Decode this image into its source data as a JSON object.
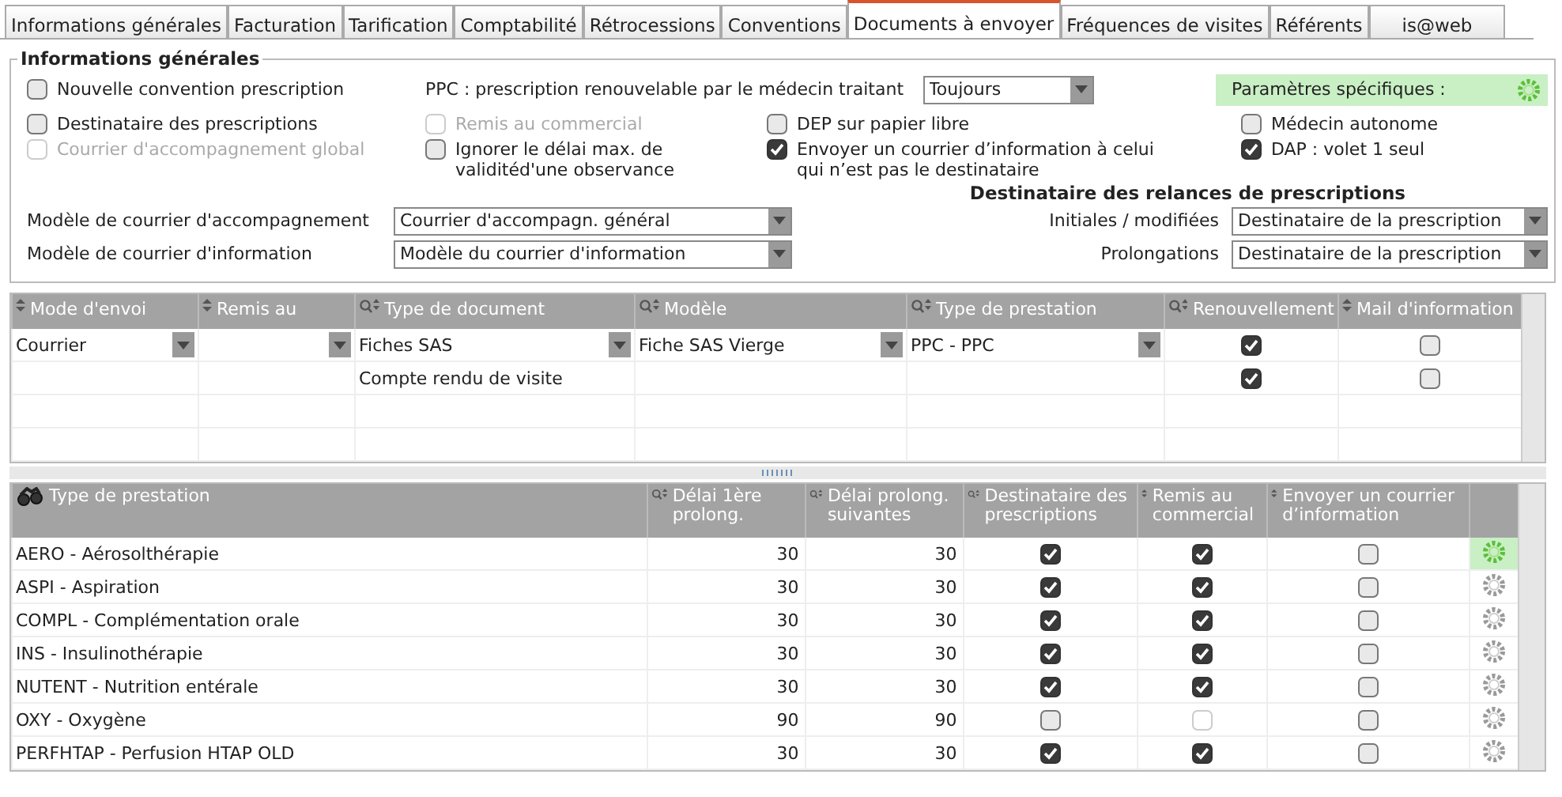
{
  "tabs": [
    {
      "label": "Informations générales",
      "selected": false
    },
    {
      "label": "Facturation",
      "selected": false
    },
    {
      "label": "Tarification",
      "selected": false
    },
    {
      "label": "Comptabilité",
      "selected": false
    },
    {
      "label": "Rétrocessions",
      "selected": false
    },
    {
      "label": "Conventions",
      "selected": false
    },
    {
      "label": "Documents à envoyer",
      "selected": true
    },
    {
      "label": "Fréquences de visites",
      "selected": false
    },
    {
      "label": "Référents",
      "selected": false
    },
    {
      "label": "is@web",
      "selected": false
    }
  ],
  "general": {
    "title": "Informations générales",
    "first_checkbox": {
      "label": "Nouvelle convention prescription",
      "checked": false,
      "disabled": false
    },
    "ppc": {
      "label": "PPC : prescription renouvelable par le médecin traitant",
      "value": "Toujours"
    },
    "specific_params": {
      "label": "Paramètres spécifiques :"
    },
    "checkbox_rows": [
      [
        {
          "label": "Destinataire des prescriptions",
          "checked": false,
          "disabled": false
        },
        {
          "label": "Remis au commercial",
          "checked": false,
          "disabled": true
        },
        {
          "label": "DEP sur papier libre",
          "checked": false,
          "disabled": false
        },
        {
          "label": "Médecin autonome",
          "checked": false,
          "disabled": false
        }
      ],
      [
        {
          "label": "Courrier d'accompagnement global",
          "checked": false,
          "disabled": true
        },
        {
          "label": "Ignorer le délai max. de validitéd'une observance",
          "checked": false,
          "disabled": false
        },
        {
          "label": "Envoyer un courrier d’information à celui qui n’est pas le destinataire",
          "checked": true,
          "disabled": false
        },
        {
          "label": "DAP : volet 1 seul",
          "checked": true,
          "disabled": false
        }
      ]
    ],
    "letter_selects": [
      {
        "label": "Modèle de courrier d'accompagnement",
        "value": "Courrier d'accompagn. général"
      },
      {
        "label": "Modèle de courrier d'information",
        "value": "Modèle du courrier d'information"
      }
    ],
    "reminders": {
      "title": "Destinataire des relances de prescriptions",
      "selects": [
        {
          "label": "Initiales / modifiées",
          "value": "Destinataire de la prescription"
        },
        {
          "label": "Prolongations",
          "value": "Destinataire de la prescription"
        }
      ]
    }
  },
  "documents": {
    "columns": [
      {
        "label": "Mode d'envoi"
      },
      {
        "label": "Remis au"
      },
      {
        "label": "Type de document"
      },
      {
        "label": "Modèle"
      },
      {
        "label": "Type de prestation"
      },
      {
        "label": "Renouvellement"
      },
      {
        "label": "Mail d'information"
      }
    ],
    "rows": [
      [
        {
          "kind": "select",
          "value": "Courrier"
        },
        {
          "kind": "select"
        },
        {
          "kind": "select",
          "value": "Fiches SAS"
        },
        {
          "kind": "select",
          "value": "Fiche SAS Vierge"
        },
        {
          "kind": "select",
          "value": "PPC - PPC"
        },
        {
          "kind": "check",
          "checked": true
        },
        {
          "kind": "check",
          "checked": false
        }
      ],
      [
        {
          "kind": "empty"
        },
        {
          "kind": "empty"
        },
        {
          "kind": "text",
          "value": "Compte rendu de visite"
        },
        {
          "kind": "empty"
        },
        {
          "kind": "empty"
        },
        {
          "kind": "check",
          "checked": true
        },
        {
          "kind": "check",
          "checked": false
        }
      ]
    ]
  },
  "services": {
    "columns": [
      {
        "label": "Type de prestation"
      },
      {
        "label": "Délai 1ère prolong."
      },
      {
        "label": "Délai prolong. suivantes"
      },
      {
        "label": "Destinataire des prescriptions"
      },
      {
        "label": "Remis au commercial"
      },
      {
        "label": "Envoyer un courrier d’information"
      }
    ],
    "rows": [
      {
        "name": "AERO - Aérosolthérapie",
        "first_delay": "30",
        "next_delay": "30",
        "recipient": {
          "checked": true,
          "disabled": false
        },
        "sales": {
          "checked": true,
          "disabled": false
        },
        "send_info": {
          "checked": false,
          "disabled": false
        },
        "highlighted": true
      },
      {
        "name": "ASPI - Aspiration",
        "first_delay": "30",
        "next_delay": "30",
        "recipient": {
          "checked": true,
          "disabled": false
        },
        "sales": {
          "checked": true,
          "disabled": false
        },
        "send_info": {
          "checked": false,
          "disabled": false
        },
        "highlighted": false
      },
      {
        "name": "COMPL - Complémentation orale",
        "first_delay": "30",
        "next_delay": "30",
        "recipient": {
          "checked": true,
          "disabled": false
        },
        "sales": {
          "checked": true,
          "disabled": false
        },
        "send_info": {
          "checked": false,
          "disabled": false
        },
        "highlighted": false
      },
      {
        "name": "INS - Insulinothérapie",
        "first_delay": "30",
        "next_delay": "30",
        "recipient": {
          "checked": true,
          "disabled": false
        },
        "sales": {
          "checked": true,
          "disabled": false
        },
        "send_info": {
          "checked": false,
          "disabled": false
        },
        "highlighted": false
      },
      {
        "name": "NUTENT - Nutrition entérale",
        "first_delay": "30",
        "next_delay": "30",
        "recipient": {
          "checked": true,
          "disabled": false
        },
        "sales": {
          "checked": true,
          "disabled": false
        },
        "send_info": {
          "checked": false,
          "disabled": false
        },
        "highlighted": false
      },
      {
        "name": "OXY - Oxygène",
        "first_delay": "90",
        "next_delay": "90",
        "recipient": {
          "checked": false,
          "disabled": false
        },
        "sales": {
          "checked": false,
          "disabled": true
        },
        "send_info": {
          "checked": false,
          "disabled": false
        },
        "highlighted": false
      },
      {
        "name": "PERFHTAP - Perfusion HTAP OLD",
        "first_delay": "30",
        "next_delay": "30",
        "recipient": {
          "checked": true,
          "disabled": false
        },
        "sales": {
          "checked": true,
          "disabled": false
        },
        "send_info": {
          "checked": false,
          "disabled": false
        },
        "highlighted": false
      }
    ]
  }
}
